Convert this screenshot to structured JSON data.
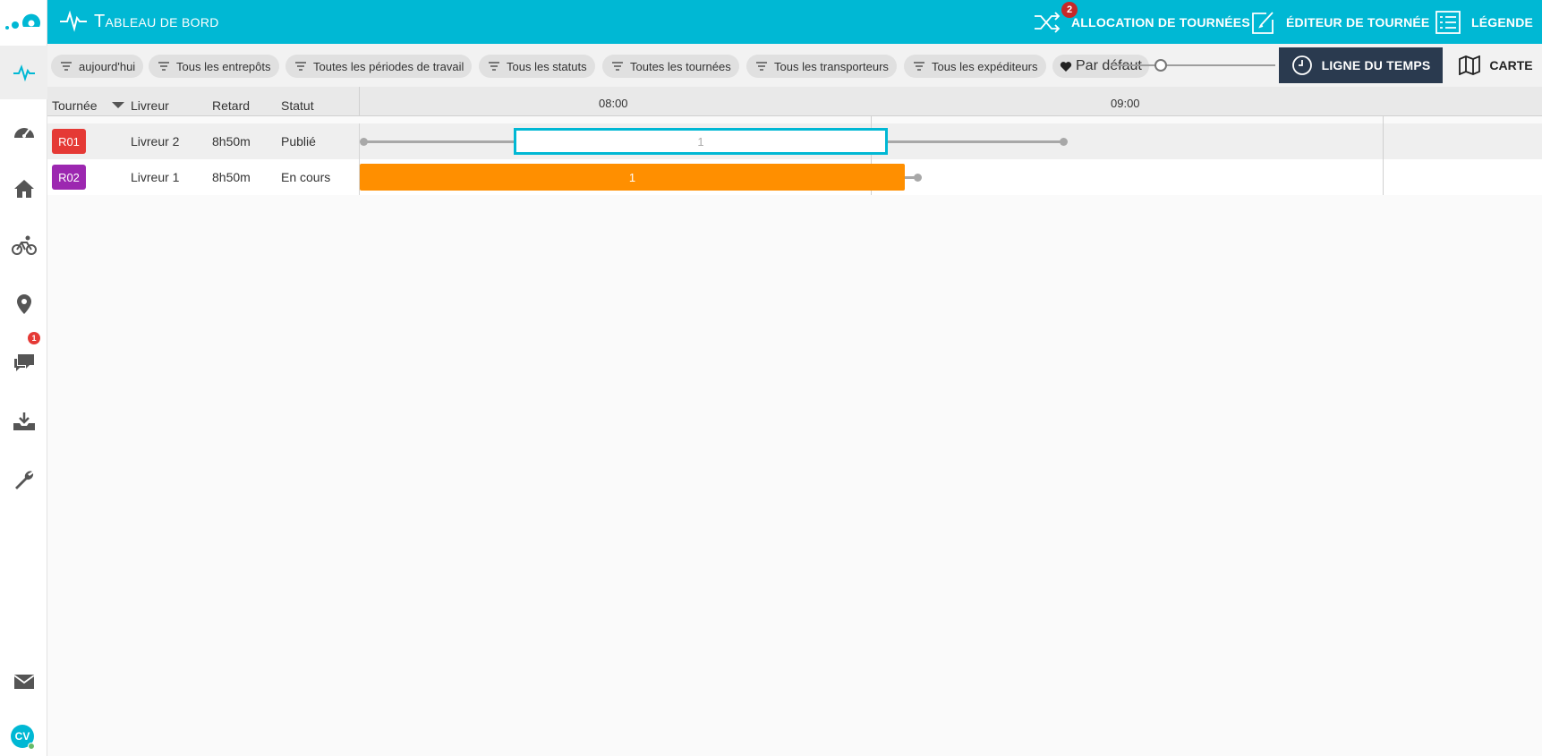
{
  "topbar": {
    "title_first": "T",
    "title_rest": "ABLEAU DE BORD",
    "actions": [
      {
        "label": "ALLOCATION DE TOURNÉES",
        "icon": "shuffle-icon",
        "badge": "2"
      },
      {
        "label": "ÉDITEUR DE TOURNÉE",
        "icon": "edit-icon"
      },
      {
        "label": "LÉGENDE",
        "icon": "list-icon"
      }
    ]
  },
  "sidebar": {
    "items": [
      {
        "icon": "pulse-icon",
        "active": true
      },
      {
        "icon": "speedometer-icon"
      },
      {
        "icon": "home-icon"
      },
      {
        "icon": "bicycle-icon"
      },
      {
        "icon": "location-pin-icon"
      },
      {
        "icon": "chat-icon",
        "badge": "1"
      },
      {
        "icon": "download-tray-icon"
      },
      {
        "icon": "wrench-icon"
      }
    ],
    "bottom": [
      {
        "icon": "mail-icon"
      }
    ],
    "avatar_initials": "CV"
  },
  "filters": [
    "aujourd'hui",
    "Tous les entrepôts",
    "Toutes les périodes de travail",
    "Tous les statuts",
    "Toutes les tournées",
    "Tous les transporteurs",
    "Tous les expéditeurs"
  ],
  "favorite_filter": "Par défaut",
  "view_buttons": {
    "timeline": "LIGNE DU TEMPS",
    "map": "CARTE"
  },
  "table": {
    "columns": [
      "Tournée",
      "Livreur",
      "Retard",
      "Statut"
    ],
    "time_labels": [
      "08:00",
      "09:00"
    ],
    "rows": [
      {
        "route": "R01",
        "route_color": "#e53935",
        "driver": "Livreur 2",
        "delay": "8h50m",
        "status": "Publié",
        "segment_label": "1"
      },
      {
        "route": "R02",
        "route_color": "#9c27b0",
        "driver": "Livreur 1",
        "delay": "8h50m",
        "status": "En cours",
        "segment_label": "1"
      }
    ]
  },
  "colors": {
    "primary": "#00b8d4",
    "timeline_button": "#2a3a4f",
    "in_progress_segment": "#ff8f00"
  }
}
